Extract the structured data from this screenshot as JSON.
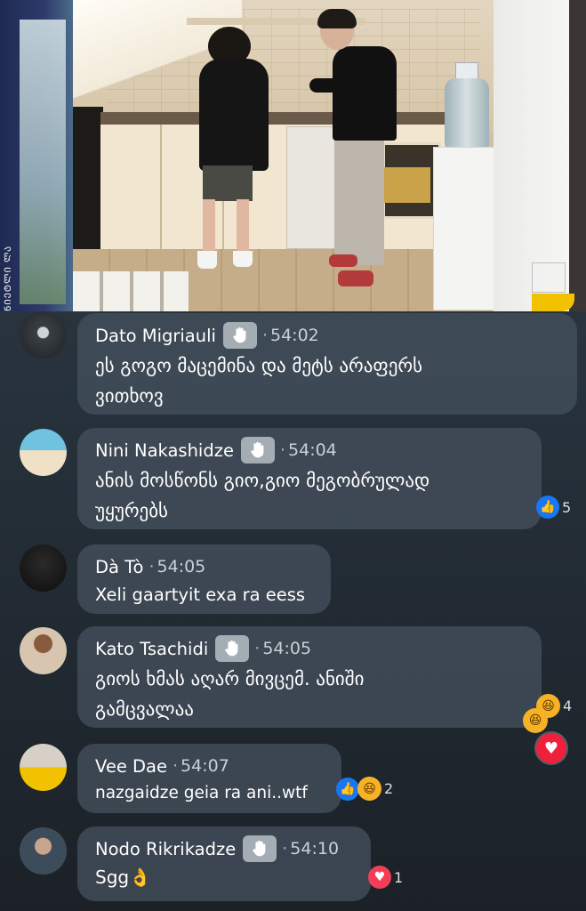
{
  "video": {
    "fridge_label": "ᲜᲘᲔᲢᲚᲘ ᲚᲐ"
  },
  "comments": [
    {
      "name": "Dato Migriauli",
      "has_badge": true,
      "time": "54:02",
      "text": "ეს გოგო მაცემინა და მეტს არაფერს\nვითხოვ",
      "reactions": null
    },
    {
      "name": "Nini Nakashidze",
      "has_badge": true,
      "time": "54:04",
      "text": "ანის მოსწონს გიო,გიო მეგობრულად\nუყურებს",
      "reactions": {
        "icons": [
          "like-icon"
        ],
        "count": "5"
      }
    },
    {
      "name": "Dà Tò",
      "has_badge": false,
      "time": "54:05",
      "text": "Xeli gaartyit exa ra eess",
      "reactions": null
    },
    {
      "name": "Kato Tsachidi",
      "has_badge": true,
      "time": "54:05",
      "text": "გიოს ხმას აღარ მივცემ. ანიში\nგამცვალაა",
      "reactions": {
        "icons": [
          "haha-icon"
        ],
        "count": "4"
      }
    },
    {
      "name": "Vee Dae",
      "has_badge": false,
      "time": "54:07",
      "text": "nazgaidze geia ra ani..wtf",
      "reactions": {
        "icons": [
          "like-icon",
          "haha-icon"
        ],
        "count": "2"
      }
    },
    {
      "name": "Nodo Rikrikadze",
      "has_badge": true,
      "time": "54:10",
      "text": "Sgg👌",
      "reactions": {
        "icons": [
          "love-icon"
        ],
        "count": "1"
      }
    }
  ],
  "colors": {
    "bubble": "#44505c",
    "like": "#1877f2",
    "haha": "#f7b125",
    "love": "#f33e58"
  }
}
